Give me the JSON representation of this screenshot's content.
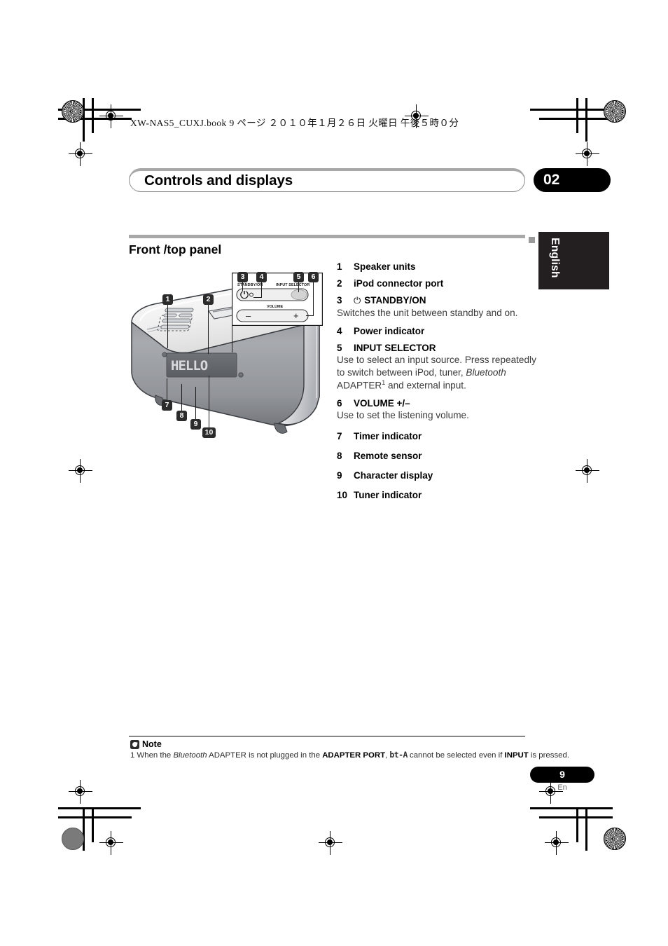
{
  "book_meta": "XW-NAS5_CUXJ.book   9 ページ   ２０１０年１月２６日   火曜日   午後５時０分",
  "header": {
    "chapter_title": "Controls and displays",
    "chapter_number": "02"
  },
  "language_tab": "English",
  "section": {
    "heading": "Front /top panel"
  },
  "parts_list": [
    {
      "num": "1",
      "label": "Speaker units",
      "desc": ""
    },
    {
      "num": "2",
      "label": "iPod connector port",
      "desc": ""
    },
    {
      "num": "3",
      "label": "STANDBY/ON",
      "icon": "power-icon",
      "glyph": "⏻",
      "desc": "Switches the unit between standby and on."
    },
    {
      "num": "4",
      "label": "Power indicator",
      "desc": ""
    },
    {
      "num": "5",
      "label": "INPUT SELECTOR",
      "desc": "Use to select an input source. Press repeatedly to switch between iPod, tuner, Bluetooth ADAPTER1 and external input.",
      "desc_parts": {
        "a": "Use to select an input source. Press repeatedly to switch between iPod, tuner, ",
        "italic": "Bluetooth",
        "b": " ADAPTER",
        "sup": "1",
        "c": " and external input."
      }
    },
    {
      "num": "6",
      "label": "VOLUME +/–",
      "desc": "Use to set the listening volume."
    },
    {
      "num": "7",
      "label": "Timer indicator",
      "desc": ""
    },
    {
      "num": "8",
      "label": "Remote sensor",
      "desc": ""
    },
    {
      "num": "9",
      "label": "Character display",
      "desc": ""
    },
    {
      "num": "10",
      "label": "Tuner indicator",
      "desc": ""
    }
  ],
  "illustration": {
    "panel_labels": {
      "standby": "STANDBY/ON",
      "input_selector": "INPUT SELECTOR",
      "volume": "VOLUME",
      "minus": "–",
      "plus": "+"
    },
    "character_display_text": "HELLO",
    "callouts": [
      "1",
      "2",
      "3",
      "4",
      "5",
      "6",
      "7",
      "8",
      "9",
      "10"
    ]
  },
  "note": {
    "title": "Note",
    "number": "1",
    "text_a": "When the ",
    "italic": "Bluetooth",
    "text_b": " ADAPTER is not plugged in the ",
    "bold_a": "ADAPTER PORT",
    "text_c": ", ",
    "segment": "bt-A",
    "text_d": " cannot be selected even if ",
    "bold_b": "INPUT",
    "text_e": " is pressed."
  },
  "footer": {
    "page_number": "9",
    "language_code": "En"
  }
}
